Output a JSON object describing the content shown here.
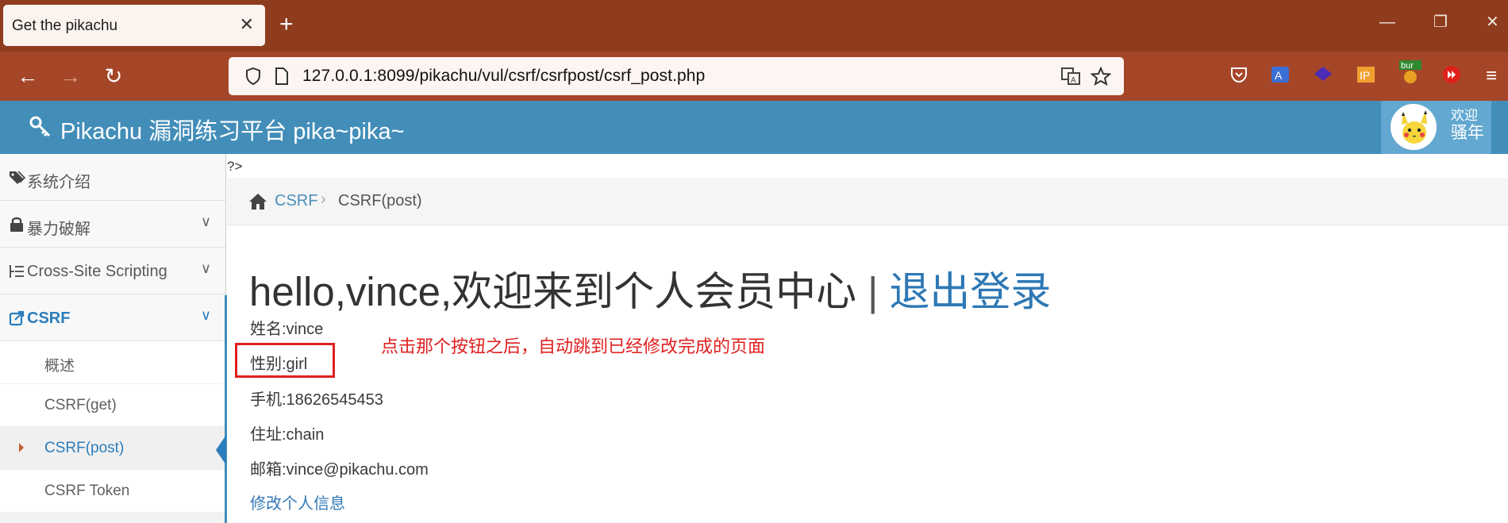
{
  "browser": {
    "tab_title": "Get the pikachu",
    "tab_close": "✕",
    "new_tab": "+",
    "url": "127.0.0.1:8099/pikachu/vul/csrf/csrfpost/csrf_post.php",
    "window_controls": {
      "minimize": "—",
      "restore": "❐",
      "close": "✕"
    }
  },
  "header": {
    "brand": "Pikachu 漏洞练习平台 pika~pika~",
    "welcome_small": "欢迎",
    "welcome_big": "骚年"
  },
  "sidebar": {
    "items": [
      {
        "label": "系统介绍",
        "icon": "tags-icon"
      },
      {
        "label": "暴力破解",
        "icon": "lock-icon",
        "arrow": "∨"
      },
      {
        "label": "Cross-Site Scripting",
        "icon": "list-icon",
        "arrow": "∨"
      },
      {
        "label": "CSRF",
        "icon": "external-link-icon",
        "arrow": "∨"
      }
    ],
    "sub_items": [
      {
        "label": "概述"
      },
      {
        "label": "CSRF(get)"
      },
      {
        "label": "CSRF(post)"
      },
      {
        "label": "CSRF Token"
      }
    ]
  },
  "main": {
    "stray_text": "?>",
    "breadcrumb": {
      "link": "CSRF",
      "sep": "›",
      "current": "CSRF(post)"
    },
    "hello": "hello,vince,欢迎来到个人会员中心",
    "hello_sep": "|",
    "logout": "退出登录",
    "info": {
      "name": "姓名:vince",
      "sex": "性别:girl",
      "phone": "手机:18626545453",
      "address": "住址:chain",
      "email": "邮箱:vince@pikachu.com"
    },
    "edit_link": "修改个人信息"
  },
  "annotation": {
    "note": "点击那个按钮之后，自动跳到已经修改完成的页面",
    "color": "#e02020"
  },
  "colors": {
    "tabbar": "#8e3b1e",
    "navbar": "#a64628",
    "header": "#438eb9",
    "link": "#2b7dbc"
  }
}
